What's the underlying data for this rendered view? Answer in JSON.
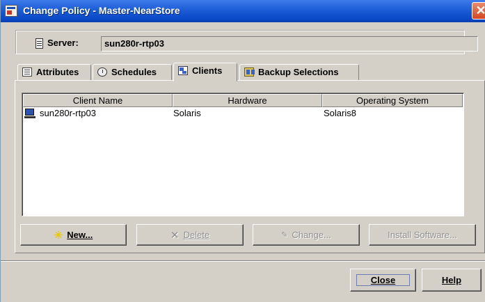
{
  "window": {
    "title": "Change Policy - Master-NearStore",
    "close_glyph": "✕"
  },
  "server": {
    "label": "Server:",
    "value": "sun280r-rtp03",
    "icon": "server-icon"
  },
  "tabs": [
    {
      "label": "Attributes",
      "icon": "attributes-icon",
      "active": false
    },
    {
      "label": "Schedules",
      "icon": "schedules-icon",
      "active": false
    },
    {
      "label": "Clients",
      "icon": "clients-icon",
      "active": true
    },
    {
      "label": "Backup Selections",
      "icon": "backup-selections-icon",
      "active": false
    }
  ],
  "clients_table": {
    "columns": [
      "Client Name",
      "Hardware",
      "Operating System"
    ],
    "rows": [
      {
        "client_name": "sun280r-rtp03",
        "hardware": "Solaris",
        "operating_system": "Solaris8",
        "icon": "computer-icon"
      }
    ]
  },
  "actions": {
    "new_label": "New...",
    "delete_label": "Delete",
    "change_label": "Change...",
    "install_software_label": "Install Software..."
  },
  "footer": {
    "close_label": "Close",
    "help_label": "Help"
  },
  "colors": {
    "titlebar": "#0a49c7",
    "window_bg": "#d4d0c8",
    "close_button": "#d4451f"
  }
}
